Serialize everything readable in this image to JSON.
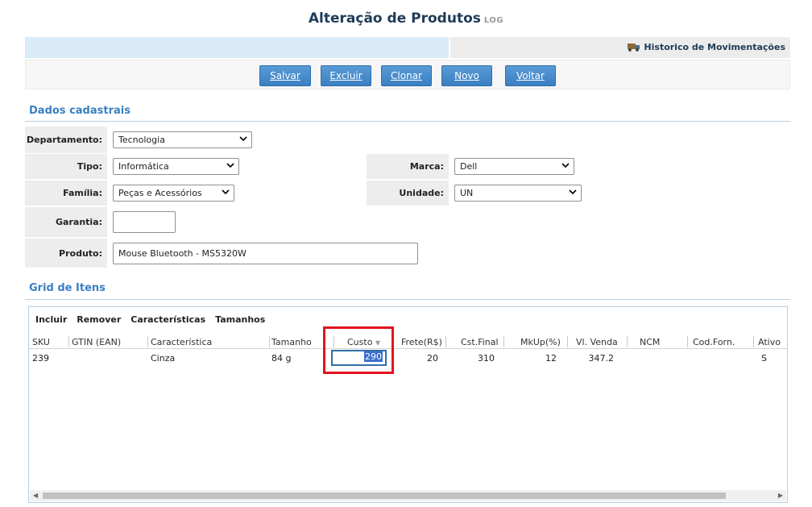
{
  "header": {
    "title": "Alteração de Produtos",
    "log": "LOG"
  },
  "topbar": {
    "historico": "Historico de Movimentações"
  },
  "actions": {
    "salvar": "Salvar",
    "excluir": "Excluir",
    "clonar": "Clonar",
    "novo": "Novo",
    "voltar": "Voltar"
  },
  "dados": {
    "section_title": "Dados cadastrais",
    "departamento": {
      "label": "Departamento:",
      "value": "Tecnologia"
    },
    "tipo": {
      "label": "Tipo:",
      "value": "Informática"
    },
    "marca": {
      "label": "Marca:",
      "value": "Dell"
    },
    "familia": {
      "label": "Família:",
      "value": "Peças e Acessórios"
    },
    "unidade": {
      "label": "Unidade:",
      "value": "UN"
    },
    "garantia": {
      "label": "Garantia:",
      "value": ""
    },
    "produto": {
      "label": "Produto:",
      "value": "Mouse Bluetooth  - MS5320W"
    }
  },
  "grid": {
    "section_title": "Grid de Itens",
    "toolbar": [
      "Incluir",
      "Remover",
      "Características",
      "Tamanhos"
    ],
    "columns": [
      "SKU",
      "GTIN (EAN)",
      "Característica",
      "Tamanho",
      "Custo",
      "Frete(R$)",
      "Cst.Final",
      "MkUp(%)",
      "Vl. Venda",
      "NCM",
      "Cod.Forn.",
      "Ativo"
    ],
    "row": {
      "sku": "239",
      "gtin": "",
      "caracteristica": "Cinza",
      "tamanho": "84 g",
      "custo": "290",
      "frete": "20",
      "cst_final": "310",
      "mkup": "12",
      "vl_venda": "347.2",
      "ncm": "",
      "cod_forn": "",
      "ativo": "S"
    }
  },
  "colors": {
    "accent": "#3a7fc2",
    "title": "#1f3b57",
    "highlight": "#e2141e"
  }
}
